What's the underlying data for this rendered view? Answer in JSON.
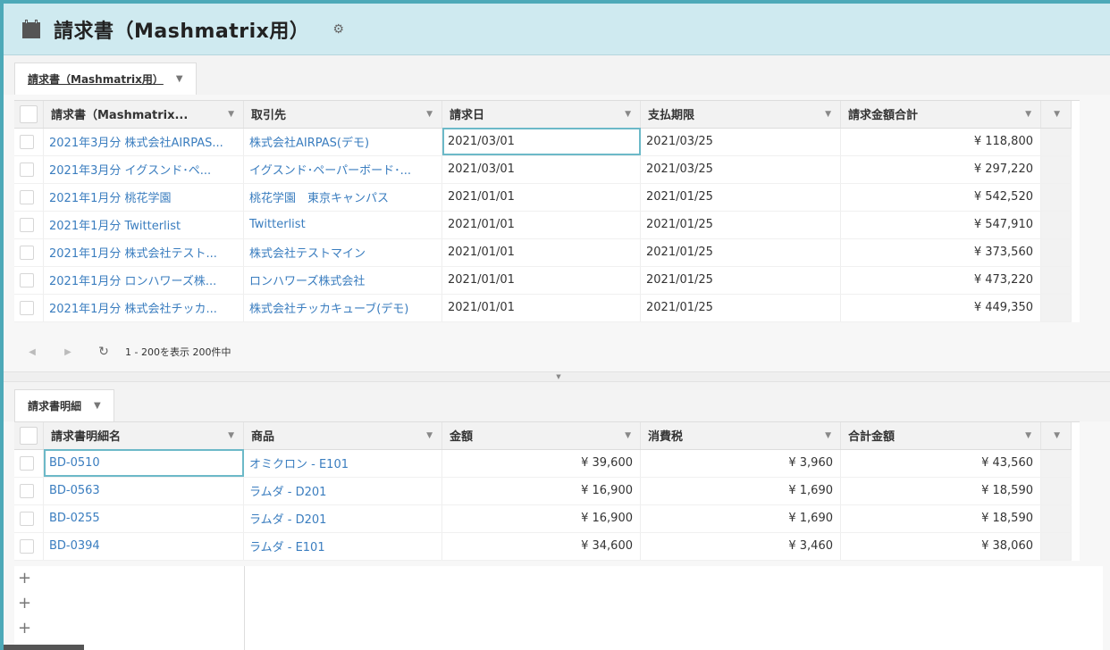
{
  "app": {
    "title": "請求書（Mashmatrix用）",
    "icon": "clipboard-icon",
    "settings_icon": "gear-icon"
  },
  "top_tab": {
    "label": "請求書（Mashmatrix用）"
  },
  "top_grid": {
    "columns": [
      "請求書（Mashmatrix...",
      "取引先",
      "請求日",
      "支払期限",
      "請求金額合計"
    ],
    "rows": [
      {
        "name": "2021年3月分 株式会社AIRPAS...",
        "account": "株式会社AIRPAS(デモ)",
        "date": "2021/03/01",
        "due": "2021/03/25",
        "total": "¥ 118,800"
      },
      {
        "name": "2021年3月分 イグスンド･ペ...",
        "account": "イグスンド･ペーパーボード･...",
        "date": "2021/03/01",
        "due": "2021/03/25",
        "total": "¥ 297,220"
      },
      {
        "name": "2021年1月分 桃花学園",
        "account": "桃花学園　東京キャンパス",
        "date": "2021/01/01",
        "due": "2021/01/25",
        "total": "¥ 542,520"
      },
      {
        "name": "2021年1月分 Twitterlist",
        "account": "Twitterlist",
        "date": "2021/01/01",
        "due": "2021/01/25",
        "total": "¥ 547,910"
      },
      {
        "name": "2021年1月分 株式会社テスト...",
        "account": "株式会社テストマイン",
        "date": "2021/01/01",
        "due": "2021/01/25",
        "total": "¥ 373,560"
      },
      {
        "name": "2021年1月分 ロンハワーズ株...",
        "account": "ロンハワーズ株式会社",
        "date": "2021/01/01",
        "due": "2021/01/25",
        "total": "¥ 473,220"
      },
      {
        "name": "2021年1月分 株式会社チッカ...",
        "account": "株式会社チッカキューブ(デモ)",
        "date": "2021/01/01",
        "due": "2021/01/25",
        "total": "¥ 449,350"
      }
    ]
  },
  "pager": {
    "count_text": "1 - 200を表示 200件中"
  },
  "bottom_tab": {
    "label": "請求書明細"
  },
  "bottom_grid": {
    "columns": [
      "請求書明細名",
      "商品",
      "金額",
      "消費税",
      "合計金額"
    ],
    "rows": [
      {
        "name": "BD-0510",
        "product": "オミクロン - E101",
        "amount": "¥ 39,600",
        "tax": "¥ 3,960",
        "total": "¥ 43,560"
      },
      {
        "name": "BD-0563",
        "product": "ラムダ - D201",
        "amount": "¥ 16,900",
        "tax": "¥ 1,690",
        "total": "¥ 18,590"
      },
      {
        "name": "BD-0255",
        "product": "ラムダ - D201",
        "amount": "¥ 16,900",
        "tax": "¥ 1,690",
        "total": "¥ 18,590"
      },
      {
        "name": "BD-0394",
        "product": "ラムダ - E101",
        "amount": "¥ 34,600",
        "tax": "¥ 3,460",
        "total": "¥ 38,060"
      }
    ]
  }
}
